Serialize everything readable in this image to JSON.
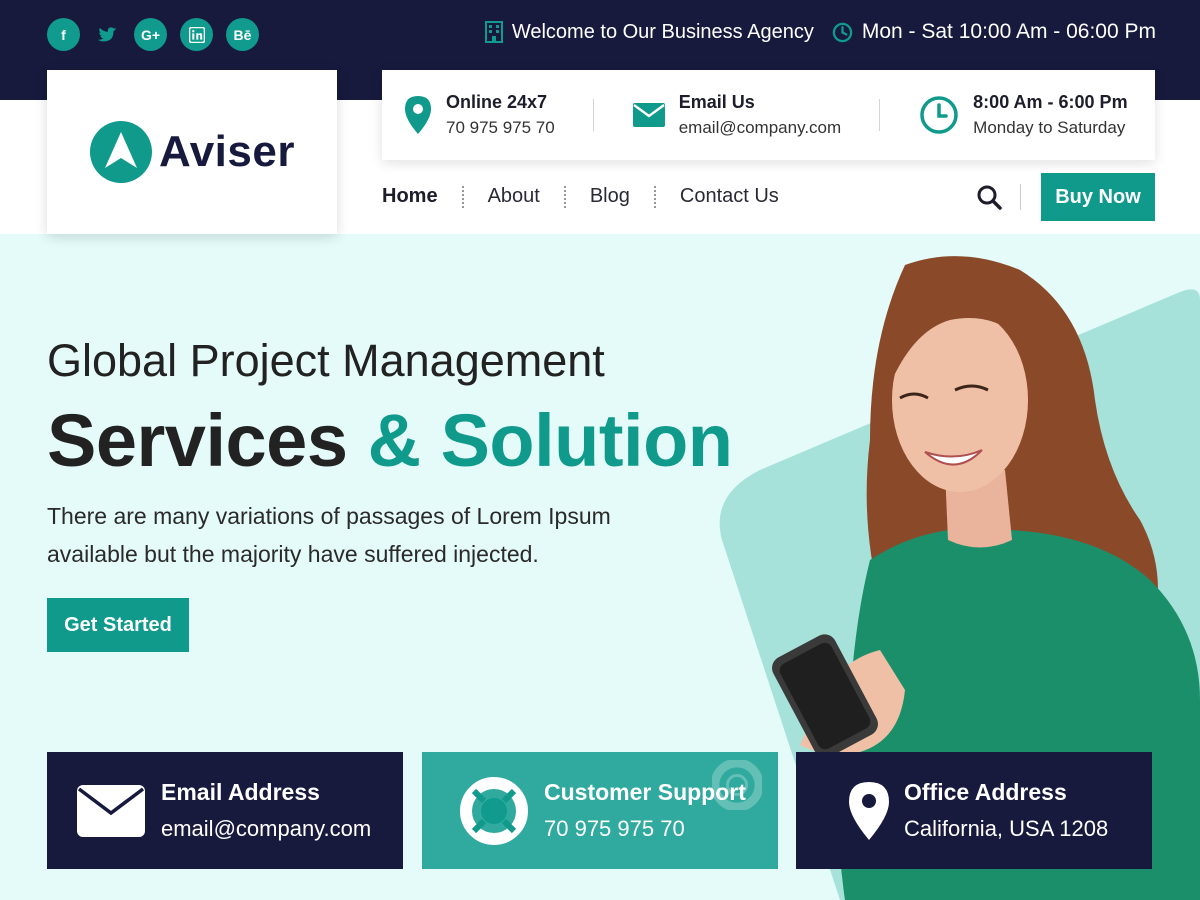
{
  "social": {
    "icons": [
      "facebook-icon",
      "twitter-icon",
      "google-plus-icon",
      "linkedin-icon",
      "behance-icon"
    ],
    "labels": [
      "f",
      "",
      "G+",
      "in",
      "Bē"
    ]
  },
  "topbar": {
    "welcome": "Welcome to Our Business Agency",
    "hours": "Mon - Sat 10:00 Am - 06:00 Pm"
  },
  "logo": {
    "name": "Aviser"
  },
  "contact_info": [
    {
      "title": "Online 24x7",
      "value": "70 975 975 70",
      "icon": "location-pin-icon"
    },
    {
      "title": "Email Us",
      "value": "email@company.com",
      "icon": "envelope-icon"
    },
    {
      "title": "8:00 Am - 6:00 Pm",
      "value": "Monday to Saturday",
      "icon": "clock-icon"
    }
  ],
  "nav": {
    "items": [
      "Home",
      "About",
      "Blog",
      "Contact Us"
    ],
    "active": "Home",
    "buy_label": "Buy Now"
  },
  "hero": {
    "subtitle": "Global Project Management",
    "title_main": "Services",
    "title_accent": "& Solution",
    "description_line1": "There are many variations of passages of Lorem Ipsum",
    "description_line2": "available but the majority have suffered injected.",
    "cta_label": "Get Started"
  },
  "features": [
    {
      "title": "Email Address",
      "value": "email@company.com",
      "icon": "envelope-icon"
    },
    {
      "title": "Customer Support",
      "value": "70 975 975 70",
      "icon": "lifebuoy-icon"
    },
    {
      "title": "Office Address",
      "value": "California, USA 1208",
      "icon": "location-pin-icon"
    }
  ],
  "colors": {
    "navy": "#171a3d",
    "teal": "#0f9a8c",
    "hero_bg": "#e4fbf9"
  }
}
